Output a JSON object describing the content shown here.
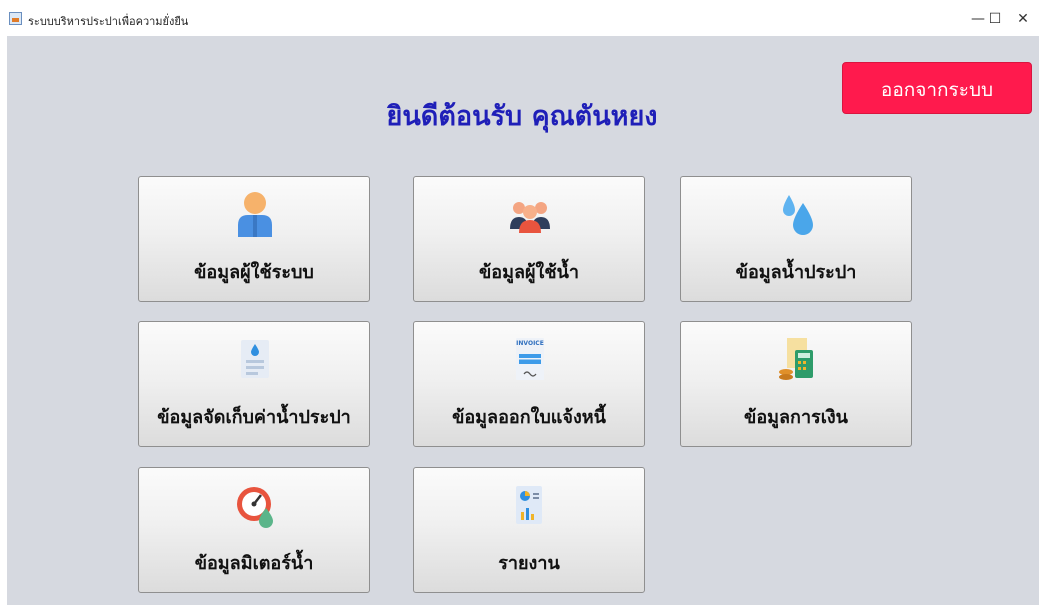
{
  "window": {
    "title": "ระบบบริหารประปาเพื่อความยั่งยืน",
    "minimize_glyph": "—",
    "maximize_glyph": "☐",
    "close_glyph": "✕"
  },
  "header": {
    "welcome": "ยินดีต้อนรับ คุณตันหยง",
    "logout_label": "ออกจากระบบ"
  },
  "menu": [
    {
      "label": "ข้อมูลผู้ใช้ระบบ",
      "icon": "user-icon"
    },
    {
      "label": "ข้อมูลผู้ใช้น้ำ",
      "icon": "group-icon"
    },
    {
      "label": "ข้อมูลน้ำประปา",
      "icon": "water-drops-icon"
    },
    {
      "label": "ข้อมูลจัดเก็บค่าน้ำประปา",
      "icon": "water-bill-icon"
    },
    {
      "label": "ข้อมูลออกใบแจ้งหนี้",
      "icon": "invoice-icon",
      "icon_text": "INVOICE"
    },
    {
      "label": "ข้อมูลการเงิน",
      "icon": "finance-calculator-icon"
    },
    {
      "label": "ข้อมูลมิเตอร์น้ำ",
      "icon": "water-meter-icon"
    },
    {
      "label": "รายงาน",
      "icon": "report-icon"
    }
  ],
  "colors": {
    "welcome_text": "#1f1fb8",
    "logout_button": "#ff1a4d",
    "background": "#d6d9e0"
  }
}
